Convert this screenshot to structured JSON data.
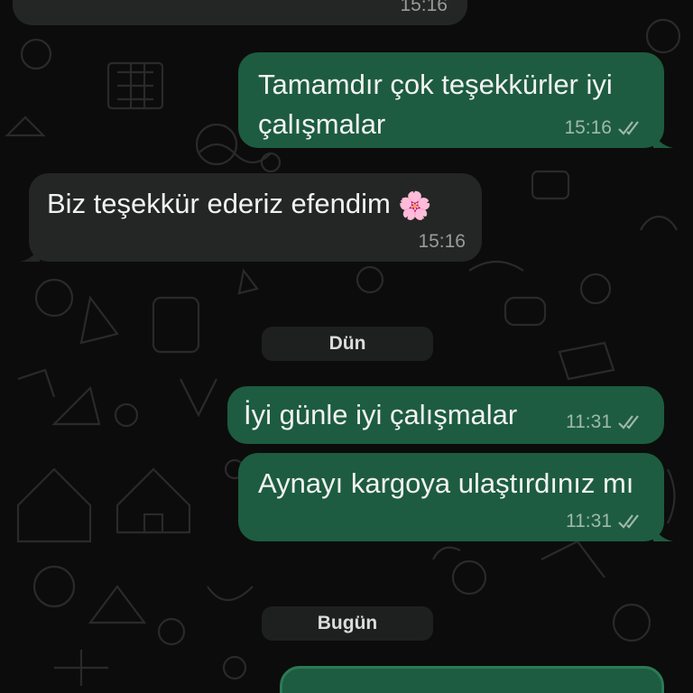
{
  "colors": {
    "outgoing_bubble": "#1d5c40",
    "incoming_bubble": "#242626",
    "background": "#0c0c0c",
    "read_ticks": "#9fb8ab"
  },
  "messages": [
    {
      "direction": "in",
      "text": "",
      "time": "15:16"
    },
    {
      "direction": "out",
      "text_line1": "Tamamdır çok teşekkürler iyi",
      "text_line2": "çalışmalar",
      "time": "15:16",
      "status_icon": "double-check-icon"
    },
    {
      "direction": "in",
      "text": "Biz teşekkür ederiz efendim",
      "emoji": "🌸",
      "emoji_icon": "cherry-blossom-icon",
      "time": "15:16"
    },
    {
      "direction": "out",
      "text": "İyi günle iyi çalışmalar",
      "time": "11:31",
      "status_icon": "double-check-icon"
    },
    {
      "direction": "out",
      "text": "Aynayı kargoya ulaştırdınız mı",
      "time": "11:31",
      "status_icon": "double-check-icon"
    }
  ],
  "day_separators": [
    {
      "label": "Dün"
    },
    {
      "label": "Bugün"
    }
  ]
}
